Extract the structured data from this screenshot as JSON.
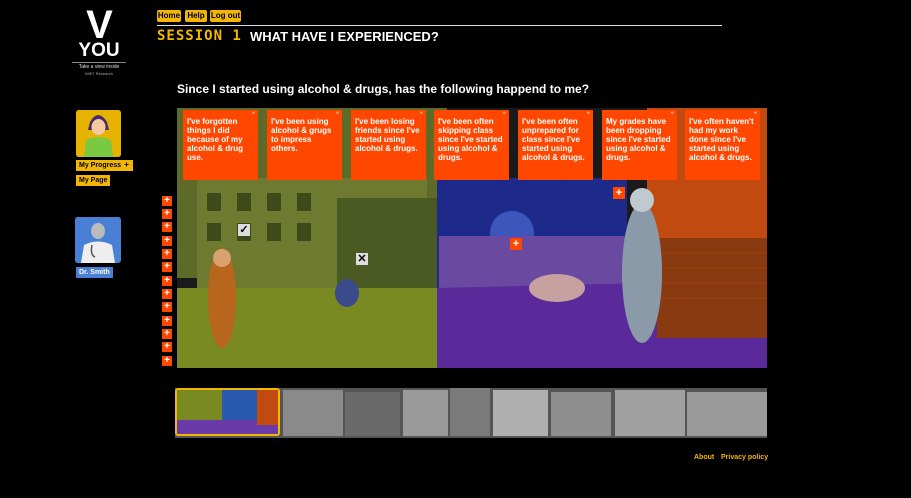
{
  "logo": {
    "mark": "V",
    "word": "YOU",
    "tagline": "Take a view inside",
    "subtitle": "IMET Research"
  },
  "sidebar": {
    "progress_label": "My Progress",
    "page_label": "My Page",
    "doctor_label": "Dr. Smith"
  },
  "nav": {
    "home": "Home",
    "help": "Help",
    "logout": "Log out"
  },
  "header": {
    "session": "SESSION 1",
    "title": "WHAT HAVE I EXPERIENCED?"
  },
  "question": "Since I started using alcohol & drugs, has the following happend to me?",
  "cards": [
    {
      "text": "I've forgotten things I did because of my alcohol & drug use."
    },
    {
      "text": "I've been using alcohol & grugs to impress others."
    },
    {
      "text": "I've been losing friends since I've started using alcohol & drugs."
    },
    {
      "text": "I've been often skipping class since I've started using alcohol & drugs."
    },
    {
      "text": "I've been often unprepared for class since I've started using alcohol & drugs."
    },
    {
      "text": "My grades have been dropping since I've started using alcohol & drugs."
    },
    {
      "text": "I've often haven't had my work done since I've started using alcohol & drugs."
    }
  ],
  "card_quote_glyph": "“",
  "plus_glyph": "+",
  "hotspots": {
    "check": "✓",
    "cross": "✕",
    "plus": "+"
  },
  "footer": {
    "about": "About",
    "privacy": "Privacy policy"
  },
  "colors": {
    "accent": "#f2b705",
    "card": "#ff4700",
    "doctor": "#4a7fd6"
  }
}
